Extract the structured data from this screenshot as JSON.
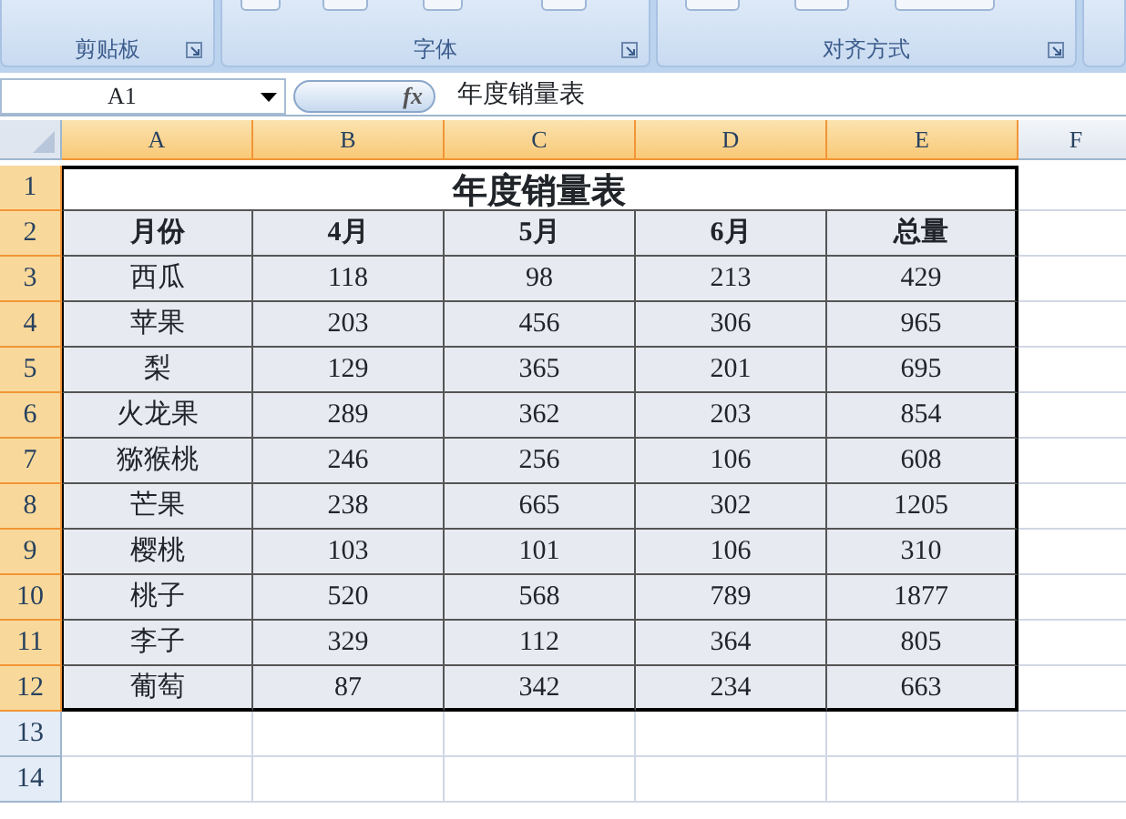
{
  "ribbon": {
    "groups": [
      {
        "label": "剪贴板"
      },
      {
        "label": "字体"
      },
      {
        "label": "对齐方式"
      }
    ]
  },
  "formula_bar": {
    "name_box": "A1",
    "function_label": "fx",
    "formula": "年度销量表"
  },
  "columns": [
    {
      "label": "A",
      "selected": true
    },
    {
      "label": "B",
      "selected": true
    },
    {
      "label": "C",
      "selected": true
    },
    {
      "label": "D",
      "selected": true
    },
    {
      "label": "E",
      "selected": true
    },
    {
      "label": "F",
      "selected": false
    }
  ],
  "row_headers": [
    {
      "label": "1",
      "selected": true
    },
    {
      "label": "2",
      "selected": true
    },
    {
      "label": "3",
      "selected": true
    },
    {
      "label": "4",
      "selected": true
    },
    {
      "label": "5",
      "selected": true
    },
    {
      "label": "6",
      "selected": true
    },
    {
      "label": "7",
      "selected": true
    },
    {
      "label": "8",
      "selected": true
    },
    {
      "label": "9",
      "selected": true
    },
    {
      "label": "10",
      "selected": true
    },
    {
      "label": "11",
      "selected": true
    },
    {
      "label": "12",
      "selected": true
    },
    {
      "label": "13",
      "selected": false
    },
    {
      "label": "14",
      "selected": false
    }
  ],
  "table": {
    "title": "年度销量表",
    "header": [
      "月份",
      "4月",
      "5月",
      "6月",
      "总量"
    ],
    "rows": [
      [
        "西瓜",
        "118",
        "98",
        "213",
        "429"
      ],
      [
        "苹果",
        "203",
        "456",
        "306",
        "965"
      ],
      [
        "梨",
        "129",
        "365",
        "201",
        "695"
      ],
      [
        "火龙果",
        "289",
        "362",
        "203",
        "854"
      ],
      [
        "猕猴桃",
        "246",
        "256",
        "106",
        "608"
      ],
      [
        "芒果",
        "238",
        "665",
        "302",
        "1205"
      ],
      [
        "樱桃",
        "103",
        "101",
        "106",
        "310"
      ],
      [
        "桃子",
        "520",
        "568",
        "789",
        "1877"
      ],
      [
        "李子",
        "329",
        "112",
        "364",
        "805"
      ],
      [
        "葡萄",
        "87",
        "342",
        "234",
        "663"
      ]
    ]
  }
}
